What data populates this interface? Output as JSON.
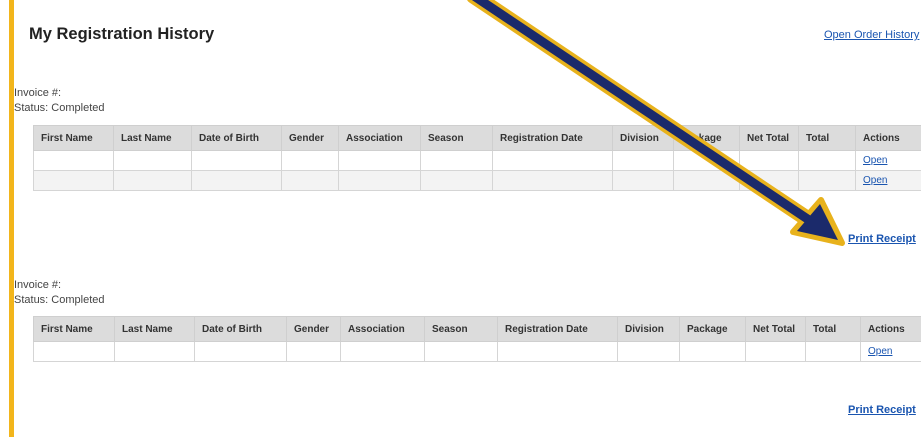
{
  "page": {
    "title": "My Registration History",
    "open_order_history": "Open Order History"
  },
  "columns": [
    "First Name",
    "Last Name",
    "Date of Birth",
    "Gender",
    "Association",
    "Season",
    "Registration Date",
    "Division",
    "Package",
    "Net Total",
    "Total",
    "Actions"
  ],
  "invoices": [
    {
      "invoice_label": "Invoice #:",
      "status_label": "Status: Completed",
      "rows": [
        {
          "action": "Open"
        },
        {
          "action": "Open"
        }
      ],
      "print_receipt": "Print Receipt"
    },
    {
      "invoice_label": "Invoice #:",
      "status_label": "Status: Completed",
      "rows": [
        {
          "action": "Open"
        }
      ],
      "print_receipt": "Print Receipt"
    }
  ],
  "annotation": {
    "arrow_color": "#1b2a6b",
    "arrow_outline_color": "#e8b21c"
  }
}
